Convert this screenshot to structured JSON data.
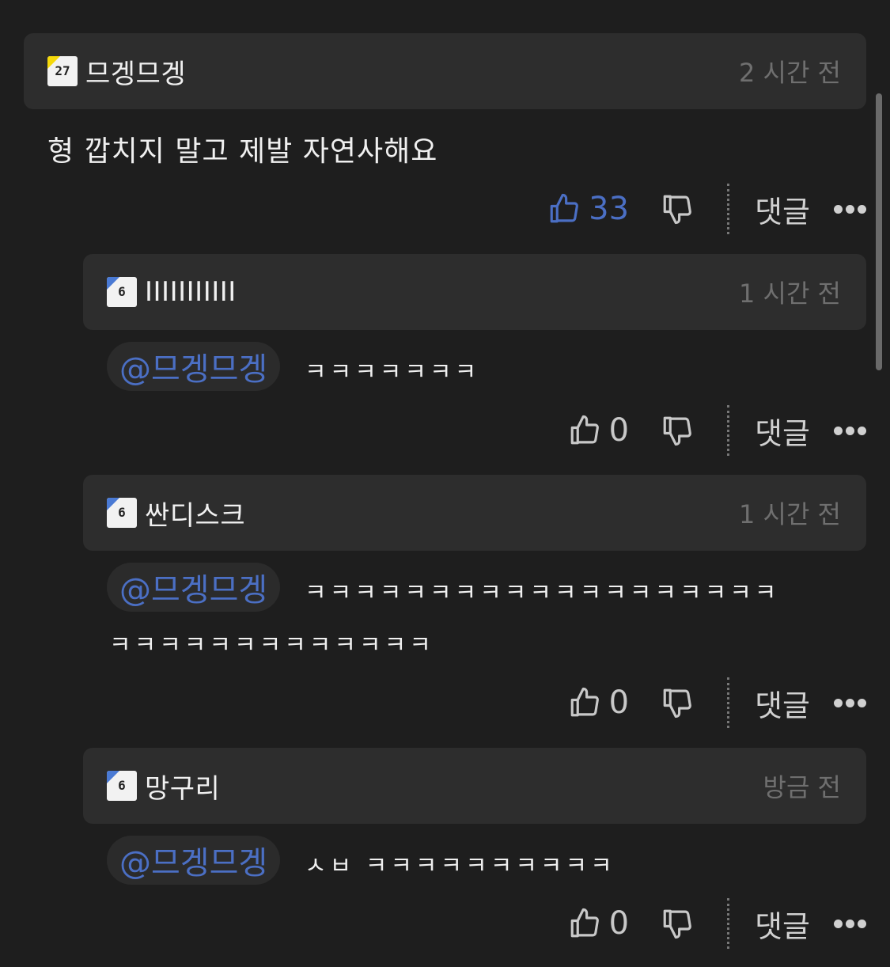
{
  "colors": {
    "background": "#1e1e1e",
    "header_bg": "#2d2d2d",
    "accent_blue": "#4b6fc4",
    "muted_text": "#6f6f6f",
    "badge_yellow": "#f5d90a",
    "badge_blue": "#4a7ad4"
  },
  "comments": [
    {
      "badge_level": "27",
      "badge_color": "yellow",
      "username": "므겡므겡",
      "time": "2 시간 전",
      "text": "형 깝치지 말고 제발 자연사해요",
      "likes": "33",
      "liked": true,
      "reply_label": "댓글"
    },
    {
      "badge_level": "6",
      "badge_color": "blue",
      "username": "IIIIIIIIIII",
      "time": "1 시간 전",
      "mention": "@므겡므겡",
      "text": "ㅋㅋㅋㅋㅋㅋㅋ",
      "likes": "0",
      "liked": false,
      "reply_label": "댓글"
    },
    {
      "badge_level": "6",
      "badge_color": "blue",
      "username": "싼디스크",
      "time": "1 시간 전",
      "mention": "@므겡므겡",
      "text_line1": "ㅋㅋㅋㅋㅋㅋㅋㅋㅋㅋㅋㅋㅋㅋㅋㅋㅋㅋㅋ",
      "text_line2": "ㅋㅋㅋㅋㅋㅋㅋㅋㅋㅋㅋㅋㅋ",
      "likes": "0",
      "liked": false,
      "reply_label": "댓글"
    },
    {
      "badge_level": "6",
      "badge_color": "blue",
      "username": "망구리",
      "time": "방금 전",
      "mention": "@므겡므겡",
      "text": "ㅅㅂ ㅋㅋㅋㅋㅋㅋㅋㅋㅋㅋ",
      "likes": "0",
      "liked": false,
      "reply_label": "댓글"
    }
  ]
}
